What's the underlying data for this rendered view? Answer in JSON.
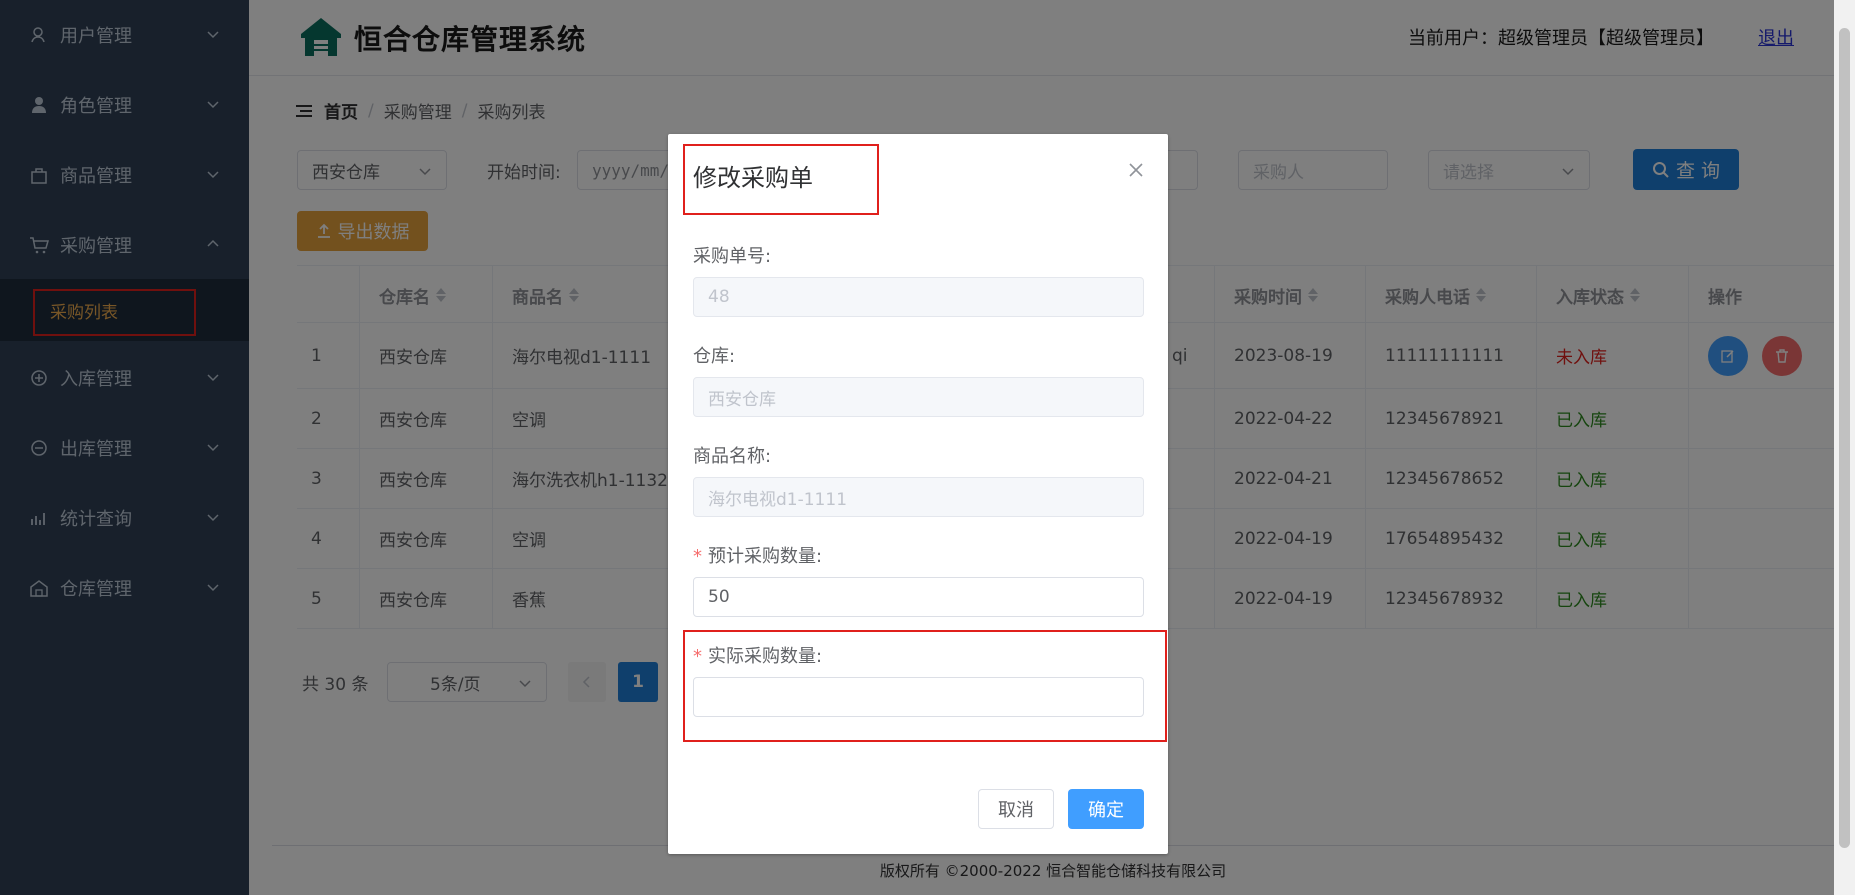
{
  "sidebar": {
    "items": [
      {
        "label": "用户管理",
        "icon": "user-manage-icon"
      },
      {
        "label": "角色管理",
        "icon": "role-icon"
      },
      {
        "label": "商品管理",
        "icon": "goods-icon"
      },
      {
        "label": "采购管理",
        "icon": "cart-icon",
        "expanded": true
      },
      {
        "label": "入库管理",
        "icon": "inbound-icon"
      },
      {
        "label": "出库管理",
        "icon": "outbound-icon"
      },
      {
        "label": "统计查询",
        "icon": "chart-icon"
      },
      {
        "label": "仓库管理",
        "icon": "warehouse-icon"
      }
    ],
    "active_sub": "采购列表"
  },
  "header": {
    "title": "恒合仓库管理系统",
    "user_info": "当前用户：超级管理员【超级管理员】",
    "logout": "退出"
  },
  "breadcrumb": {
    "home": "首页",
    "level1": "采购管理",
    "level2": "采购列表"
  },
  "filters": {
    "warehouse": "西安仓库",
    "start_label": "开始时间:",
    "start_placeholder": "yyyy/mm/",
    "buyer_placeholder": "采购人",
    "status_placeholder": "请选择",
    "search_label": "查 询",
    "export_label": "导出数据"
  },
  "table": {
    "headers": {
      "warehouse": "仓库名",
      "product": "商品名",
      "time": "采购时间",
      "phone": "采购人电话",
      "status": "入库状态",
      "ops": "操作"
    },
    "rows": [
      {
        "idx": "1",
        "warehouse": "西安仓库",
        "product": "海尔电视d1-1111",
        "buyer_tail": "qi",
        "time": "2023-08-19",
        "phone": "11111111111",
        "status": "未入库"
      },
      {
        "idx": "2",
        "warehouse": "西安仓库",
        "product": "空调",
        "buyer_tail": "",
        "time": "2022-04-22",
        "phone": "12345678921",
        "status": "已入库"
      },
      {
        "idx": "3",
        "warehouse": "西安仓库",
        "product": "海尔洗衣机h1-1132",
        "buyer_tail": "",
        "time": "2022-04-21",
        "phone": "12345678652",
        "status": "已入库"
      },
      {
        "idx": "4",
        "warehouse": "西安仓库",
        "product": "空调",
        "buyer_tail": "",
        "time": "2022-04-19",
        "phone": "17654895432",
        "status": "已入库"
      },
      {
        "idx": "5",
        "warehouse": "西安仓库",
        "product": "香蕉",
        "buyer_tail": "",
        "time": "2022-04-19",
        "phone": "12345678932",
        "status": "已入库"
      }
    ]
  },
  "pagination": {
    "total": "共 30 条",
    "page_size": "5条/页",
    "current": "1"
  },
  "footer": "版权所有 ©2000-2022  恒合智能仓储科技有限公司",
  "dialog": {
    "title": "修改采购单",
    "order_no_label": "采购单号:",
    "order_no_value": "48",
    "warehouse_label": "仓库:",
    "warehouse_value": "西安仓库",
    "product_label": "商品名称:",
    "product_value": "海尔电视d1-1111",
    "expected_label": "预计采购数量:",
    "expected_value": "50",
    "actual_label": "实际采购数量:",
    "actual_value": "",
    "cancel": "取消",
    "confirm": "确定"
  },
  "colors": {
    "sidebar_bg": "#304156",
    "accent": "#409eff",
    "highlight_box": "#e0201c",
    "status_red": "#e0201c",
    "status_green": "#2c8a1e"
  }
}
